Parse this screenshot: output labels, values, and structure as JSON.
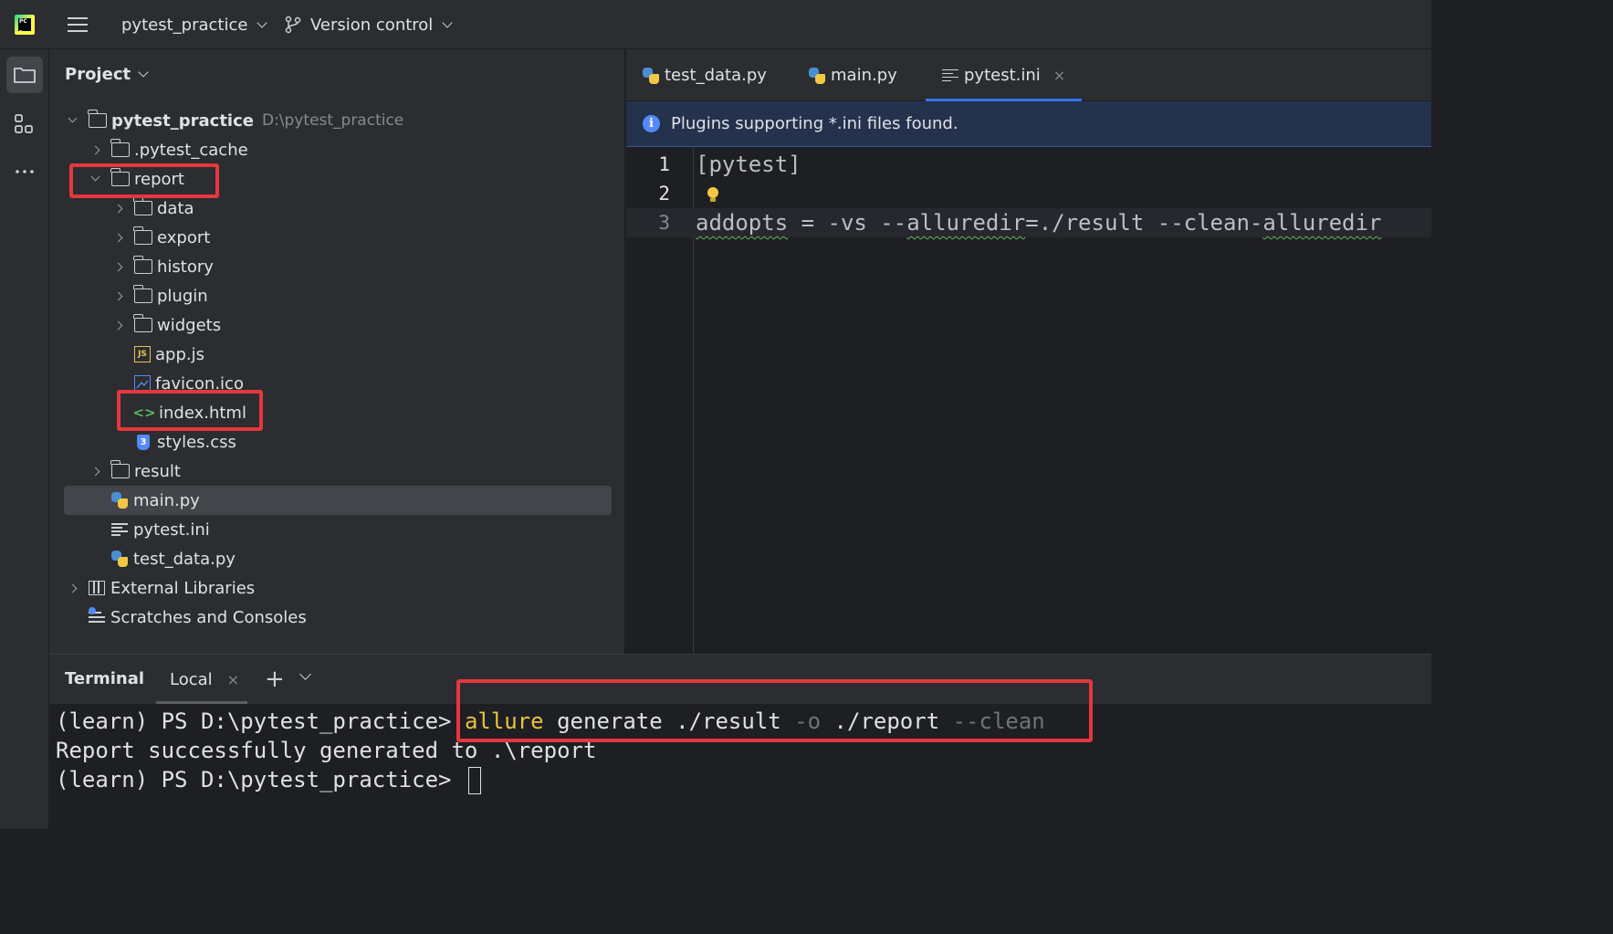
{
  "titlebar": {
    "project_name": "pytest_practice",
    "vcs_label": "Version control"
  },
  "project_panel": {
    "title": "Project",
    "tree": [
      {
        "label": "pytest_practice",
        "hint": "D:\\pytest_practice",
        "type": "folder",
        "expanded": true
      },
      {
        "label": ".pytest_cache",
        "type": "folder",
        "expanded": false
      },
      {
        "label": "report",
        "type": "folder",
        "expanded": true
      },
      {
        "label": "data",
        "type": "folder",
        "expanded": false
      },
      {
        "label": "export",
        "type": "folder",
        "expanded": false
      },
      {
        "label": "history",
        "type": "folder",
        "expanded": false
      },
      {
        "label": "plugin",
        "type": "folder",
        "expanded": false
      },
      {
        "label": "widgets",
        "type": "folder",
        "expanded": false
      },
      {
        "label": "app.js",
        "type": "js",
        "icon_text": "JS"
      },
      {
        "label": "favicon.ico",
        "type": "ico"
      },
      {
        "label": "index.html",
        "type": "html",
        "icon_text": "<>"
      },
      {
        "label": "styles.css",
        "type": "css",
        "icon_text": "3"
      },
      {
        "label": "result",
        "type": "folder",
        "expanded": false
      },
      {
        "label": "main.py",
        "type": "python",
        "selected": true
      },
      {
        "label": "pytest.ini",
        "type": "ini"
      },
      {
        "label": "test_data.py",
        "type": "python"
      },
      {
        "label": "External Libraries",
        "type": "library",
        "expanded": false
      },
      {
        "label": "Scratches and Consoles",
        "type": "scratches"
      }
    ]
  },
  "editor": {
    "tabs": [
      {
        "label": "test_data.py",
        "icon": "python-icon"
      },
      {
        "label": "main.py",
        "icon": "python-icon"
      },
      {
        "label": "pytest.ini",
        "icon": "ini-file-icon",
        "active": true,
        "close": "×"
      }
    ],
    "banner": "Plugins supporting *.ini files found.",
    "banner_icon": "i",
    "lines": [
      {
        "num": "1",
        "text": "[pytest]"
      },
      {
        "num": "2",
        "text": ""
      },
      {
        "num": "3",
        "key": "addopts",
        "rest_a": " = -vs --",
        "alluredir": "alluredir",
        "rest_b": "=./result --clean-",
        "alluredir2": "alluredir"
      }
    ]
  },
  "terminal": {
    "title": "Terminal",
    "tab_label": "Local",
    "tab_close": "×",
    "add_label": "+",
    "line1": {
      "prompt": "(learn) PS D:\\pytest_practice> ",
      "cmd": "allure",
      "arg1": " generate ./result ",
      "opt1": "-o",
      "arg2": " ./report ",
      "opt2": "--clean"
    },
    "line2": "Report successfully generated to .\\report",
    "line3": "(learn) PS D:\\pytest_practice> "
  },
  "colors": {
    "highlight_box": "#e5373d",
    "accent": "#3574f0",
    "command_keyword": "#e8c33e"
  }
}
